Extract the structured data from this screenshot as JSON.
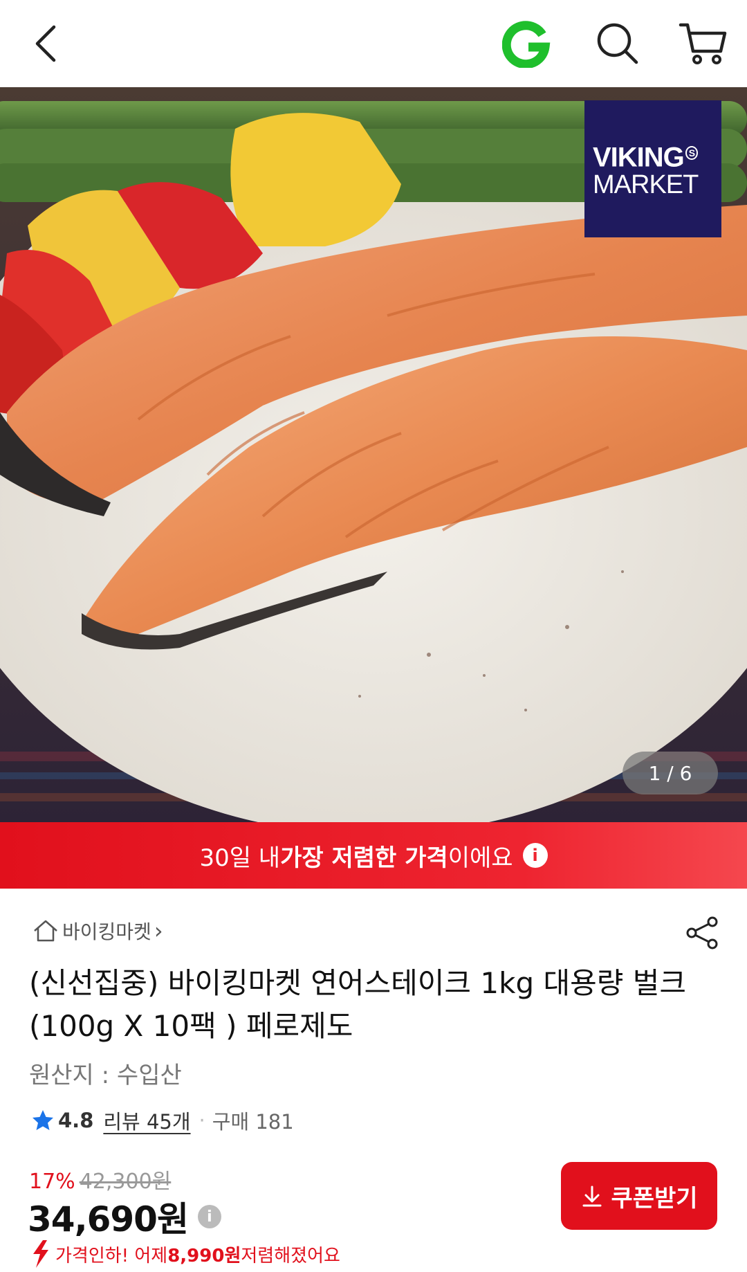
{
  "header": {
    "back_icon": "chevron-left-icon",
    "brand_icon": "gmarket-g-logo",
    "search_icon": "search-icon",
    "cart_icon": "cart-icon"
  },
  "hero": {
    "brand_logo_line1": "VIKING",
    "brand_logo_sup": "S",
    "brand_logo_line2": "MARKET",
    "pager": "1 / 6"
  },
  "banner": {
    "text_pre": "30일 내 ",
    "text_bold": "가장 저렴한 가격",
    "text_post": "이에요",
    "info_symbol": "i"
  },
  "product": {
    "store_name": "바이킹마켓",
    "store_chevron": "›",
    "title": "(신선집중) 바이킹마켓 연어스테이크 1kg 대용량 벌크 (100g X 10팩 ) 페로제도",
    "origin": "원산지 : 수입산",
    "rating": "4.8",
    "reviews": "리뷰 45개",
    "dot": "·",
    "purchases": "구매 181"
  },
  "pricing": {
    "discount": "17%",
    "original_price": "42,300원",
    "price": "34,690원",
    "price_info_symbol": "i",
    "drop_pre": "가격인하! 어제 ",
    "drop_amount": "8,990원",
    "drop_post": " 저렴해졌어요",
    "coupon_label": "쿠폰받기"
  },
  "colors": {
    "accent": "#e1101c",
    "brand_logo_bg": "#1f1a5e",
    "gmarket_green": "#1fbf2c",
    "star_blue": "#1a73e8"
  }
}
